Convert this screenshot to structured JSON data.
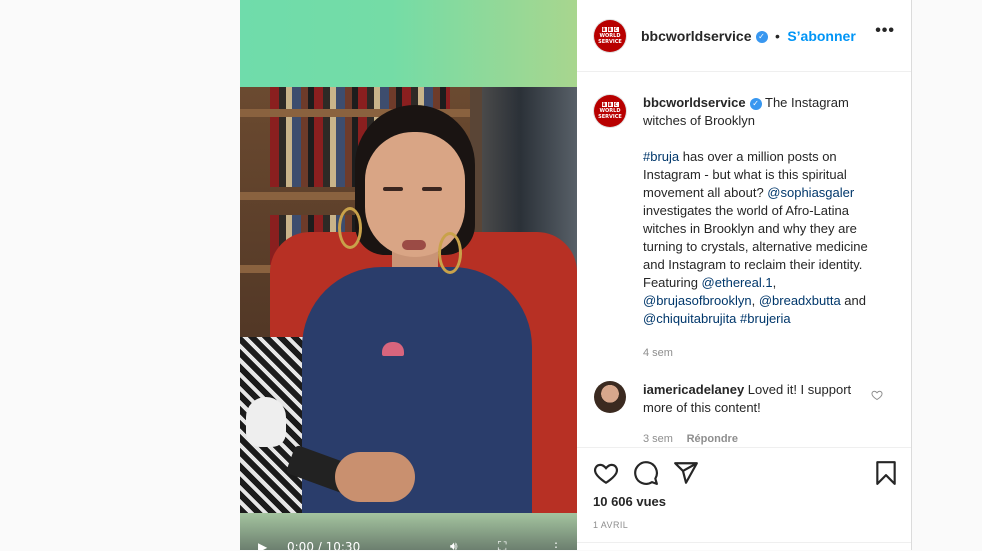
{
  "account": {
    "username": "bbcworldservice",
    "follow_label": "S’abonner",
    "avatar_text": [
      "B",
      "B",
      "C"
    ],
    "avatar_sub": [
      "WORLD",
      "SERVICE"
    ],
    "verified_icon": "verified-badge-icon",
    "more_label": "•••"
  },
  "caption": {
    "username": "bbcworldservice",
    "title": "The Instagram witches of Brooklyn",
    "hashtag1": "#bruja",
    "text1": " has over a million posts on Instagram - but what is this spiritual movement all about? ",
    "mention1": "@sophiasgaler",
    "text2": " investigates the world of Afro-Latina witches in Brooklyn and why they are turning to crystals, alternative medicine and Instagram to reclaim their identity. Featuring ",
    "mention2": "@ethereal.1",
    "text3": ", ",
    "mention3": "@brujasofbrooklyn",
    "text4": ", ",
    "mention4": "@breadxbutta",
    "text5": " and ",
    "mention5": "@chiquitabrujita",
    "text6": " ",
    "hashtag2": "#brujeria",
    "time": "4 sem"
  },
  "comment": {
    "username": "iamericadelaney",
    "text": " Loved it! I support more of this content!",
    "time": "3 sem",
    "reply_label": "Répondre"
  },
  "actions": {
    "like_icon": "heart-icon",
    "comment_icon": "comment-icon",
    "share_icon": "send-icon",
    "save_icon": "bookmark-icon",
    "views": "10 606 vues",
    "date": "1 AVRIL"
  },
  "video": {
    "current_time": "0:00",
    "duration": "10:30",
    "time_display": "0:00 / 10:30",
    "play_icon": "play-icon",
    "volume_icon": "volume-icon",
    "fullscreen_icon": "fullscreen-icon",
    "options_icon": "more-vertical-icon"
  },
  "colors": {
    "link": "#00376b",
    "follow": "#0095f6",
    "verified": "#3897f0",
    "brand": "#b80000"
  }
}
